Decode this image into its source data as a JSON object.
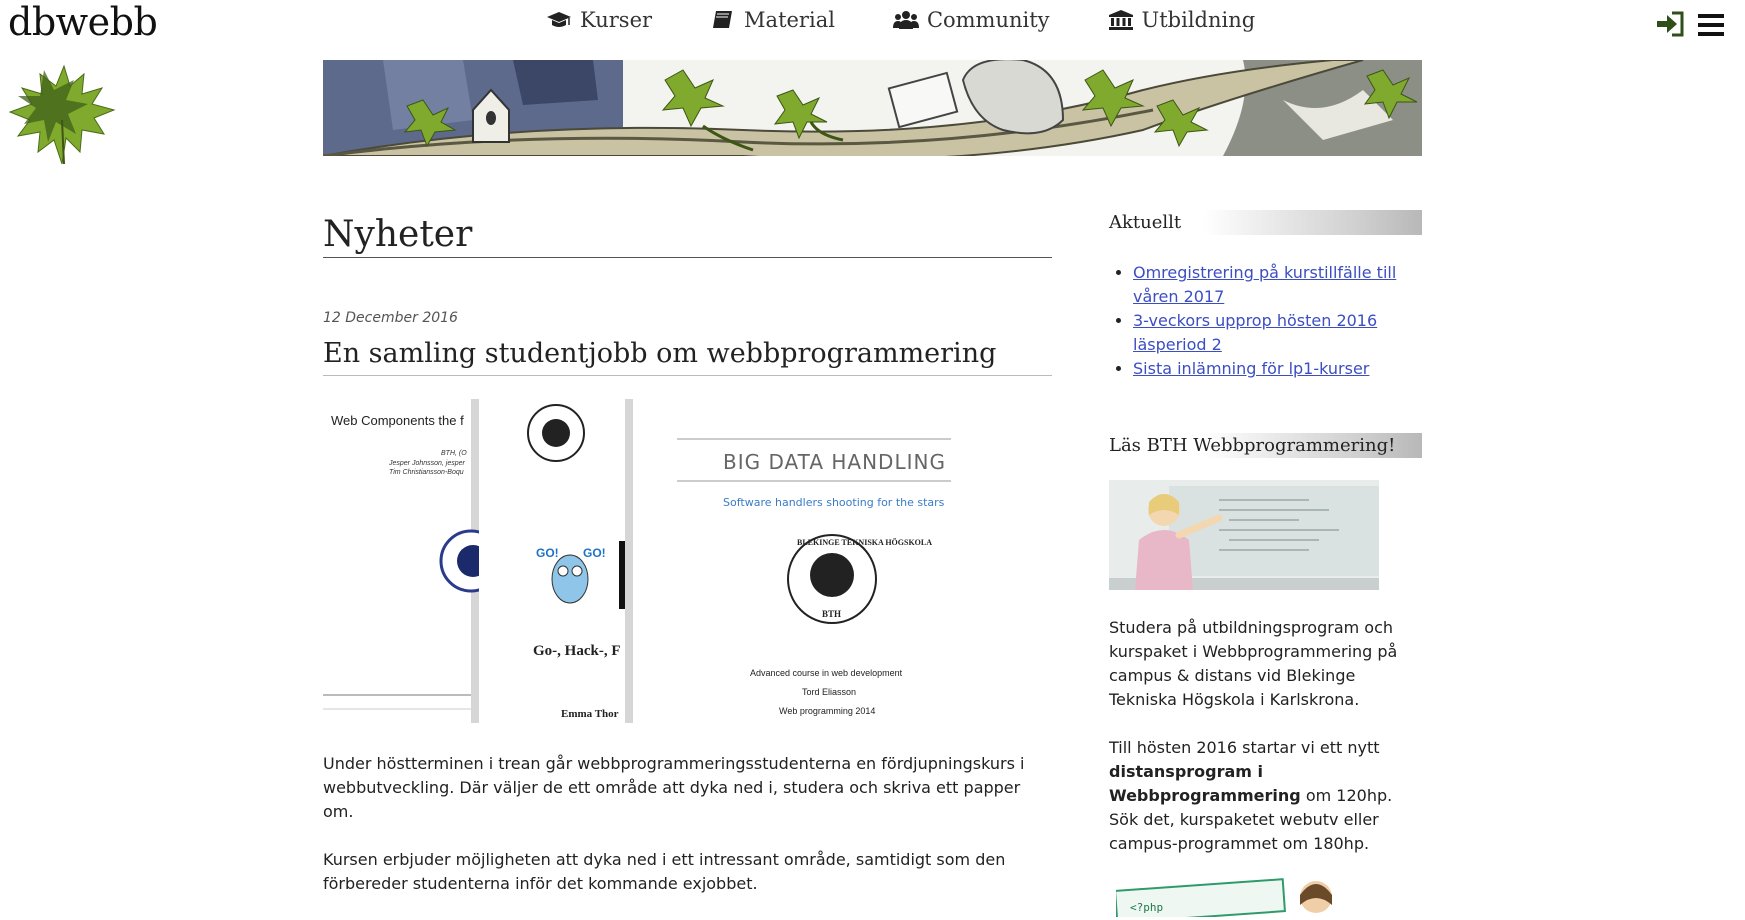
{
  "site": {
    "logo_text": "dbwebb"
  },
  "nav": {
    "items": [
      {
        "label": "Kurser",
        "icon": "graduation-cap-icon"
      },
      {
        "label": "Material",
        "icon": "book-icon"
      },
      {
        "label": "Community",
        "icon": "users-icon"
      },
      {
        "label": "Utbildning",
        "icon": "university-icon"
      }
    ]
  },
  "header_icons": [
    "login-icon",
    "hamburger-menu-icon"
  ],
  "main": {
    "page_title": "Nyheter",
    "post": {
      "date": "12 December 2016",
      "title": "En samling studentjobb om webbprogrammering",
      "figure": {
        "doc1_title": "Web Components the f",
        "doc1_lines": [
          "BTH, (O",
          "Jesper Johnsson, jesper",
          "Tim Christiansson-Boqu"
        ],
        "doc2_go_label": "GO!",
        "doc2_title": "Go-, Hack-, F",
        "doc2_author": "Emma Thor",
        "doc3_title": "BIG DATA HANDLING",
        "doc3_subtitle": "Software handlers shooting for the stars",
        "doc3_seal_text": "BLEKINGE TEKNISKA HÖGSKOLA",
        "doc3_seal_bottom": "BTH",
        "doc3_footer": [
          "Advanced course in web development",
          "Tord Eliasson",
          "Web programming 2014"
        ]
      },
      "paragraphs": [
        "Under höstterminen i trean går webbprogrammeringsstudenterna en fördjupningskurs i webbutveckling. Där väljer de ett område att dyka ned i, studera och skriva ett papper om.",
        "Kursen erbjuder möjligheten att dyka ned i ett intressant område, samtidigt som den förbereder studenterna inför det kommande exjobbet."
      ]
    }
  },
  "sidebar": {
    "aktuellt": {
      "heading": "Aktuellt",
      "links": [
        "Omregistrering på kurstillfälle till våren 2017",
        "3-veckors upprop hösten 2016 läsperiod 2",
        "Sista inlämning för lp1-kurser"
      ]
    },
    "promo": {
      "heading": "Läs BTH Webbprogrammering!",
      "p1": "Studera på utbildningsprogram och kurspaket i Webbprogrammering på campus & distans vid Blekinge Tekniska Högskola i Karlskrona.",
      "p2_before": "Till hösten 2016 startar vi ett nytt ",
      "p2_bold": "distansprogram i Webbprogrammering",
      "p2_after": " om 120hp. Sök det, kurspaketet webutv eller campus-programmet om 180hp.",
      "bottom_snippet": "<?php"
    }
  },
  "colors": {
    "link": "#3b4ec2",
    "leaf_green": "#6b9a2a",
    "heading_grey": "#b8b8b8"
  }
}
